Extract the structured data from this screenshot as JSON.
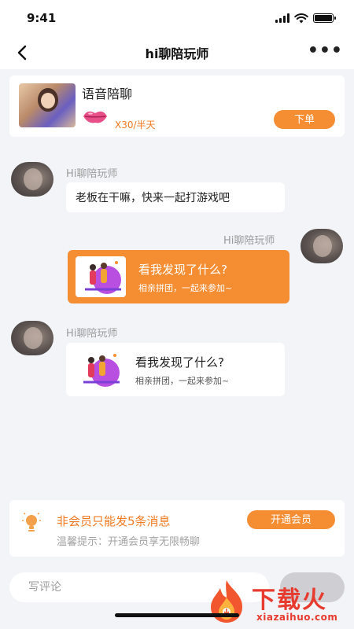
{
  "status_bar": {
    "time": "9:41"
  },
  "nav": {
    "title": "hi聊陪玩师"
  },
  "service": {
    "name": "语音陪聊",
    "price": "X30/半天",
    "order_label": "下单"
  },
  "messages": [
    {
      "sender": "Hi聊陪玩师",
      "text": "老板在干嘛，快来一起打游戏吧"
    },
    {
      "sender": "Hi聊陪玩师",
      "card_title": "看我发现了什么?",
      "card_sub": "相亲拼团，一起来参加~"
    },
    {
      "sender": "Hi聊陪玩师",
      "card_title": "看我发现了什么?",
      "card_sub": "相亲拼团，一起来参加~"
    }
  ],
  "member": {
    "title": "非会员只能发5条消息",
    "hint": "温馨提示：开通会员享无限畅聊",
    "button_label": "开通会员"
  },
  "input": {
    "placeholder": "写评论"
  },
  "watermark": {
    "brand": "下载火",
    "domain": "xiazaihuo.com"
  },
  "colors": {
    "accent": "#f58d33",
    "accent_text": "#f07a22",
    "background": "#f3f4f8"
  }
}
